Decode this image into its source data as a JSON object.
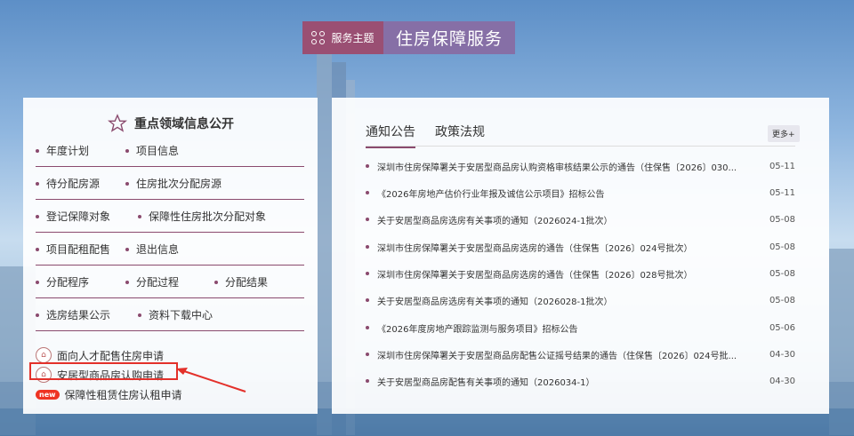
{
  "header": {
    "service_label": "服务主题",
    "title": "住房保障服务"
  },
  "left_panel": {
    "title": "重点领域信息公开",
    "rows": [
      [
        "年度计划",
        "项目信息"
      ],
      [
        "待分配房源",
        "住房批次分配房源"
      ],
      [
        "登记保障对象",
        "保障性住房批次分配对象"
      ],
      [
        "项目配租配售",
        "退出信息"
      ],
      [
        "分配程序",
        "分配过程",
        "分配结果"
      ],
      [
        "选房结果公示",
        "资料下载中心"
      ]
    ],
    "applications": [
      {
        "label": "面向人才配售住房申请",
        "icon": "document-icon"
      },
      {
        "label": "安居型商品房认购申请",
        "icon": "document-icon"
      },
      {
        "label": "保障性租赁住房认租申请",
        "icon": "new",
        "badge": "new"
      }
    ]
  },
  "right_panel": {
    "tabs": [
      "通知公告",
      "政策法规"
    ],
    "more_label": "更多+",
    "news": [
      {
        "title": "深圳市住房保障署关于安居型商品房认购资格审核结果公示的通告（住保售〔2026〕030...",
        "date": "05-11"
      },
      {
        "title": "《2026年房地产估价行业年报及诚信公示项目》招标公告",
        "date": "05-11"
      },
      {
        "title": "关于安居型商品房选房有关事项的通知（2026024-1批次）",
        "date": "05-08"
      },
      {
        "title": "深圳市住房保障署关于安居型商品房选房的通告（住保售〔2026〕024号批次）",
        "date": "05-08"
      },
      {
        "title": "深圳市住房保障署关于安居型商品房选房的通告（住保售〔2026〕028号批次）",
        "date": "05-08"
      },
      {
        "title": "关于安居型商品房选房有关事项的通知（2026028-1批次）",
        "date": "05-08"
      },
      {
        "title": "《2026年度房地产跟踪监测与服务项目》招标公告",
        "date": "05-06"
      },
      {
        "title": "深圳市住房保障署关于安居型商品房配售公证摇号结果的通告（住保售〔2026〕024号批...",
        "date": "04-30"
      },
      {
        "title": "关于安居型商品房配售有关事项的通知（2026034-1）",
        "date": "04-30"
      }
    ]
  }
}
